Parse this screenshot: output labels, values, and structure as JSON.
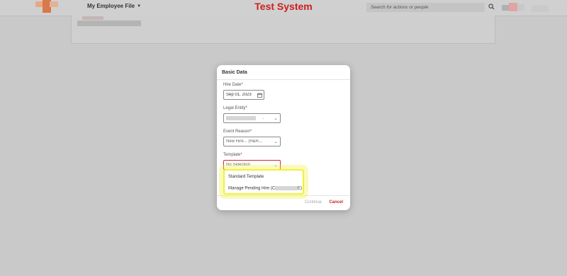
{
  "shell": {
    "module_label": "My Employee File",
    "system_title": "Test System",
    "search_placeholder": "Search for actions or people"
  },
  "dialog": {
    "title": "Basic Data",
    "fields": {
      "hire_date": {
        "label": "Hire Date",
        "required": "*",
        "value": "Sep 01, 2023"
      },
      "legal_entity": {
        "label": "Legal Entity",
        "required": "*",
        "value": "."
      },
      "event_reason": {
        "label": "Event Reason",
        "required": "*",
        "value": "New Hire... (H&R..."
      },
      "template": {
        "label": "Template",
        "required": "*",
        "value": "No Selection"
      }
    },
    "template_options": [
      {
        "label": "Standard Template"
      },
      {
        "label": "Manage Pending Hire (C",
        "suffix": "E)"
      }
    ],
    "buttons": {
      "continue": "Continue",
      "cancel": "Cancel"
    }
  },
  "colors": {
    "brand": "#cc1e1e",
    "highlight": "#f1f13a"
  }
}
